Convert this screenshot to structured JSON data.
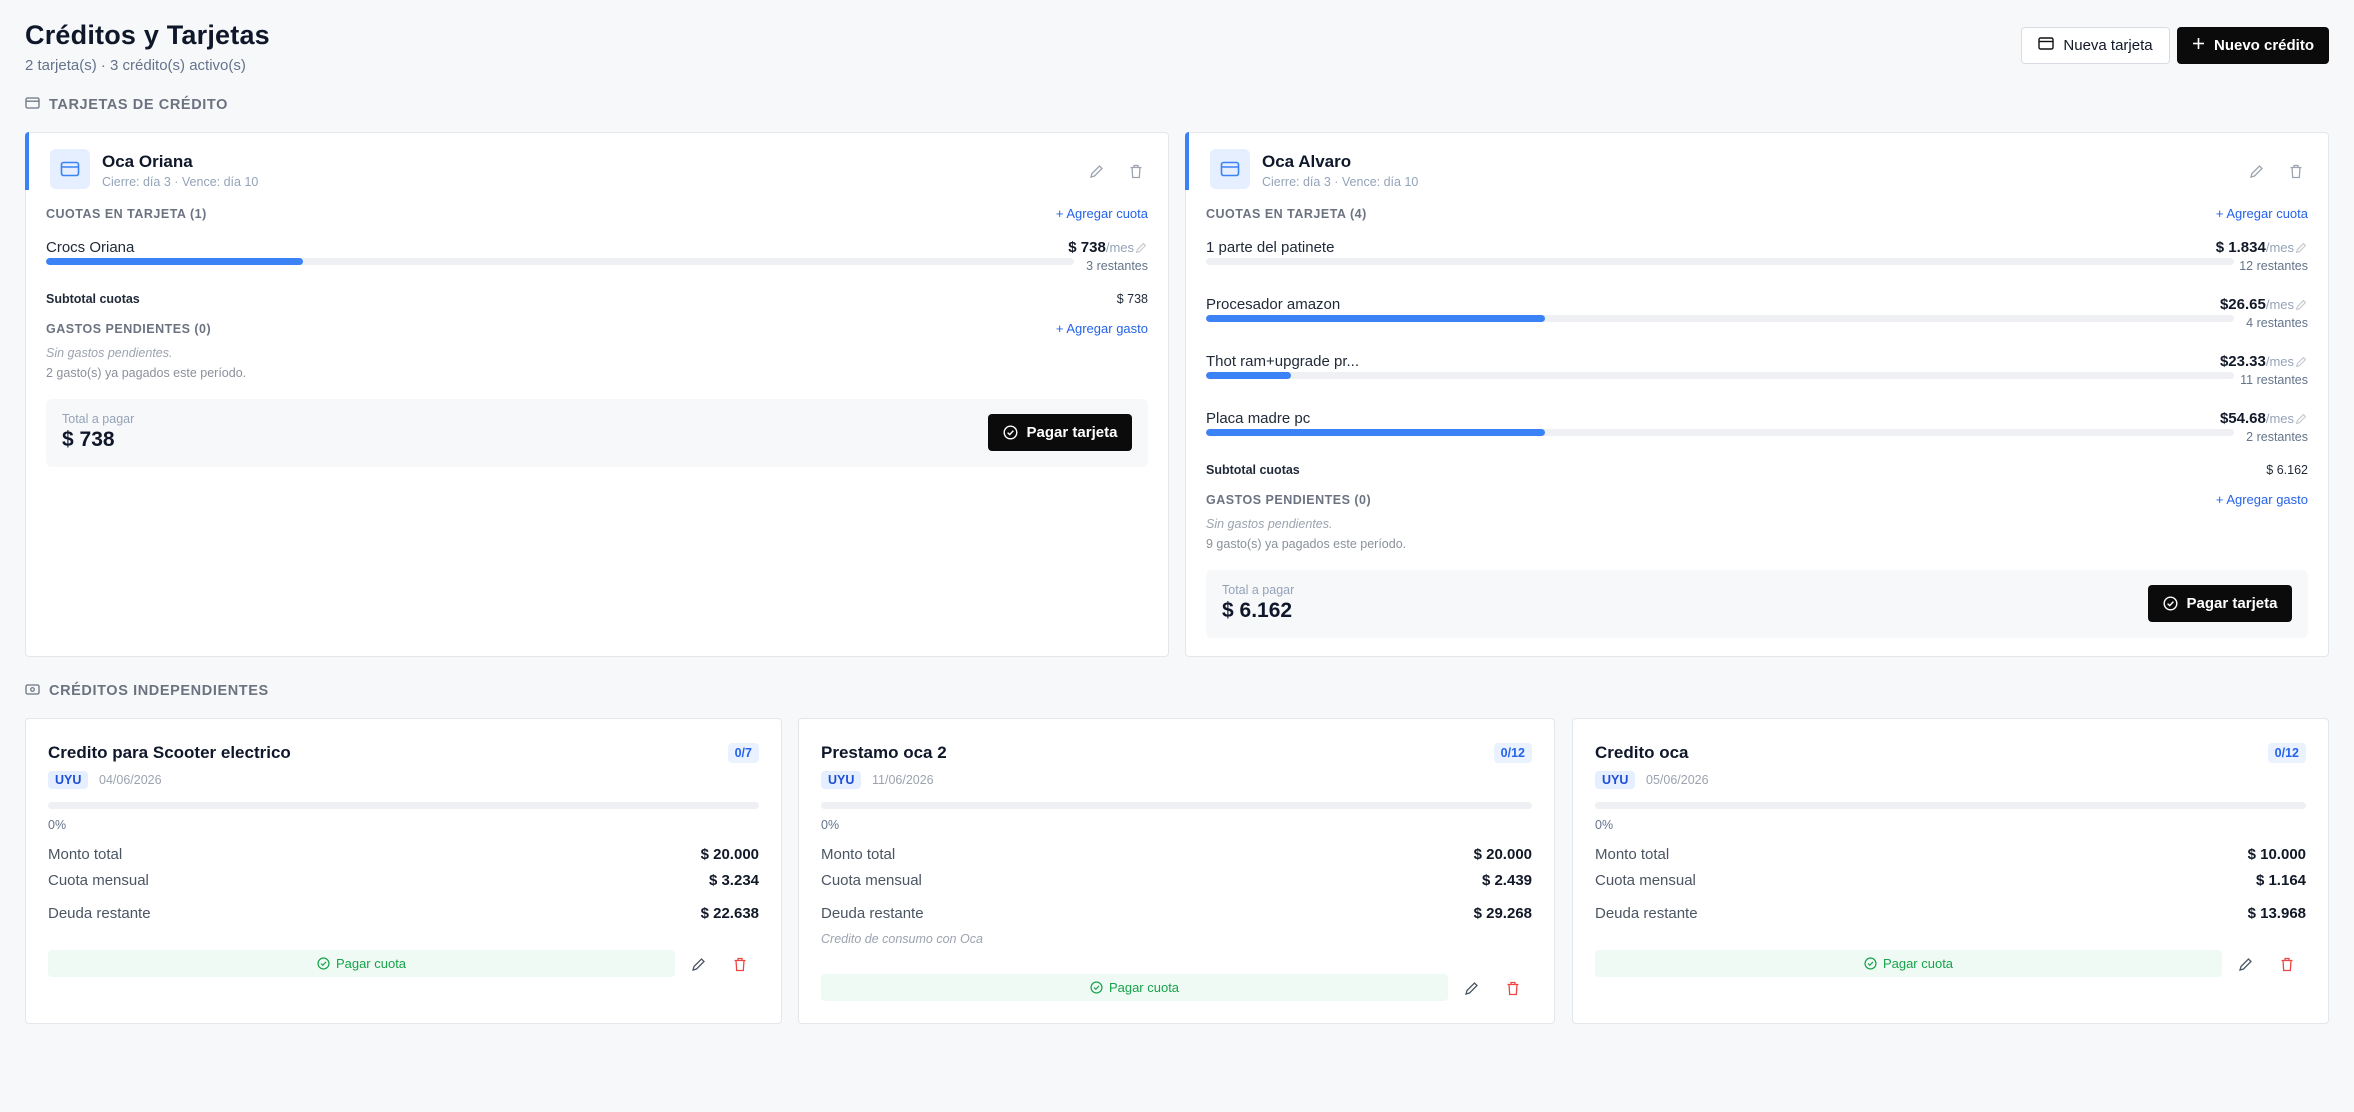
{
  "header": {
    "title": "Créditos y Tarjetas",
    "subtitle": "2 tarjeta(s) · 3 crédito(s) activo(s)",
    "new_card_label": "Nueva tarjeta",
    "new_credit_label": "Nuevo crédito"
  },
  "sections": {
    "cards_title": "TARJETAS DE CRÉDITO",
    "loans_title": "CRÉDITOS INDEPENDIENTES"
  },
  "cards": [
    {
      "name": "Oca Oriana",
      "meta": "Cierre: día 3 · Vence: día 10",
      "installments_title": "CUOTAS EN TARJETA (1)",
      "add_installment": "+ Agregar cuota",
      "installments": [
        {
          "name": "Crocs Oriana",
          "amount": "$ 738",
          "per": "/mes",
          "remaining": "3 restantes",
          "progress": 0.25
        }
      ],
      "subtotal_label": "Subtotal cuotas",
      "subtotal_value": "$ 738",
      "pending_title": "GASTOS PENDIENTES (0)",
      "add_expense": "+ Agregar gasto",
      "no_pending": "Sin gastos pendientes.",
      "paid_note": "2 gasto(s) ya pagados este período.",
      "total_label": "Total a pagar",
      "total_value": "$ 738",
      "pay_label": "Pagar tarjeta"
    },
    {
      "name": "Oca Alvaro",
      "meta": "Cierre: día 3 · Vence: día 10",
      "installments_title": "CUOTAS EN TARJETA (4)",
      "add_installment": "+ Agregar cuota",
      "installments": [
        {
          "name": "1 parte del patinete",
          "amount": "$ 1.834",
          "per": "/mes",
          "remaining": "12 restantes",
          "progress": 0
        },
        {
          "name": "Procesador amazon",
          "amount": "$26.65",
          "per": "/mes",
          "remaining": "4 restantes",
          "progress": 0.33
        },
        {
          "name": "Thot ram+upgrade pr...",
          "amount": "$23.33",
          "per": "/mes",
          "remaining": "11 restantes",
          "progress": 0.083
        },
        {
          "name": "Placa madre pc",
          "amount": "$54.68",
          "per": "/mes",
          "remaining": "2 restantes",
          "progress": 0.33
        }
      ],
      "subtotal_label": "Subtotal cuotas",
      "subtotal_value": "$ 6.162",
      "pending_title": "GASTOS PENDIENTES (0)",
      "add_expense": "+ Agregar gasto",
      "no_pending": "Sin gastos pendientes.",
      "paid_note": "9 gasto(s) ya pagados este período.",
      "total_label": "Total a pagar",
      "total_value": "$ 6.162",
      "pay_label": "Pagar tarjeta"
    }
  ],
  "loans": [
    {
      "name": "Credito para Scooter electrico",
      "badge": "0/7",
      "currency": "UYU",
      "date": "04/06/2026",
      "progress": 0,
      "percent": "0%",
      "total_label": "Monto total",
      "total": "$ 20.000",
      "monthly_label": "Cuota mensual",
      "monthly": "$ 3.234",
      "debt_label": "Deuda restante",
      "debt": "$ 22.638",
      "note": "",
      "pay_label": "Pagar cuota"
    },
    {
      "name": "Prestamo oca 2",
      "badge": "0/12",
      "currency": "UYU",
      "date": "11/06/2026",
      "progress": 0,
      "percent": "0%",
      "total_label": "Monto total",
      "total": "$ 20.000",
      "monthly_label": "Cuota mensual",
      "monthly": "$ 2.439",
      "debt_label": "Deuda restante",
      "debt": "$ 29.268",
      "note": "Credito de consumo con Oca",
      "pay_label": "Pagar cuota"
    },
    {
      "name": "Credito oca",
      "badge": "0/12",
      "currency": "UYU",
      "date": "05/06/2026",
      "progress": 0,
      "percent": "0%",
      "total_label": "Monto total",
      "total": "$ 10.000",
      "monthly_label": "Cuota mensual",
      "monthly": "$ 1.164",
      "debt_label": "Deuda restante",
      "debt": "$ 13.968",
      "note": "",
      "pay_label": "Pagar cuota"
    }
  ],
  "icons": {
    "card": "credit-card-icon",
    "plus": "plus-icon",
    "edit": "pencil-icon",
    "delete": "trash-icon",
    "check": "check-circle-icon",
    "loan": "banknote-icon"
  },
  "colors": {
    "accent": "#3b82f6",
    "dark": "#0b0b0b",
    "success": "#16a34a",
    "danger": "#ef4444"
  }
}
